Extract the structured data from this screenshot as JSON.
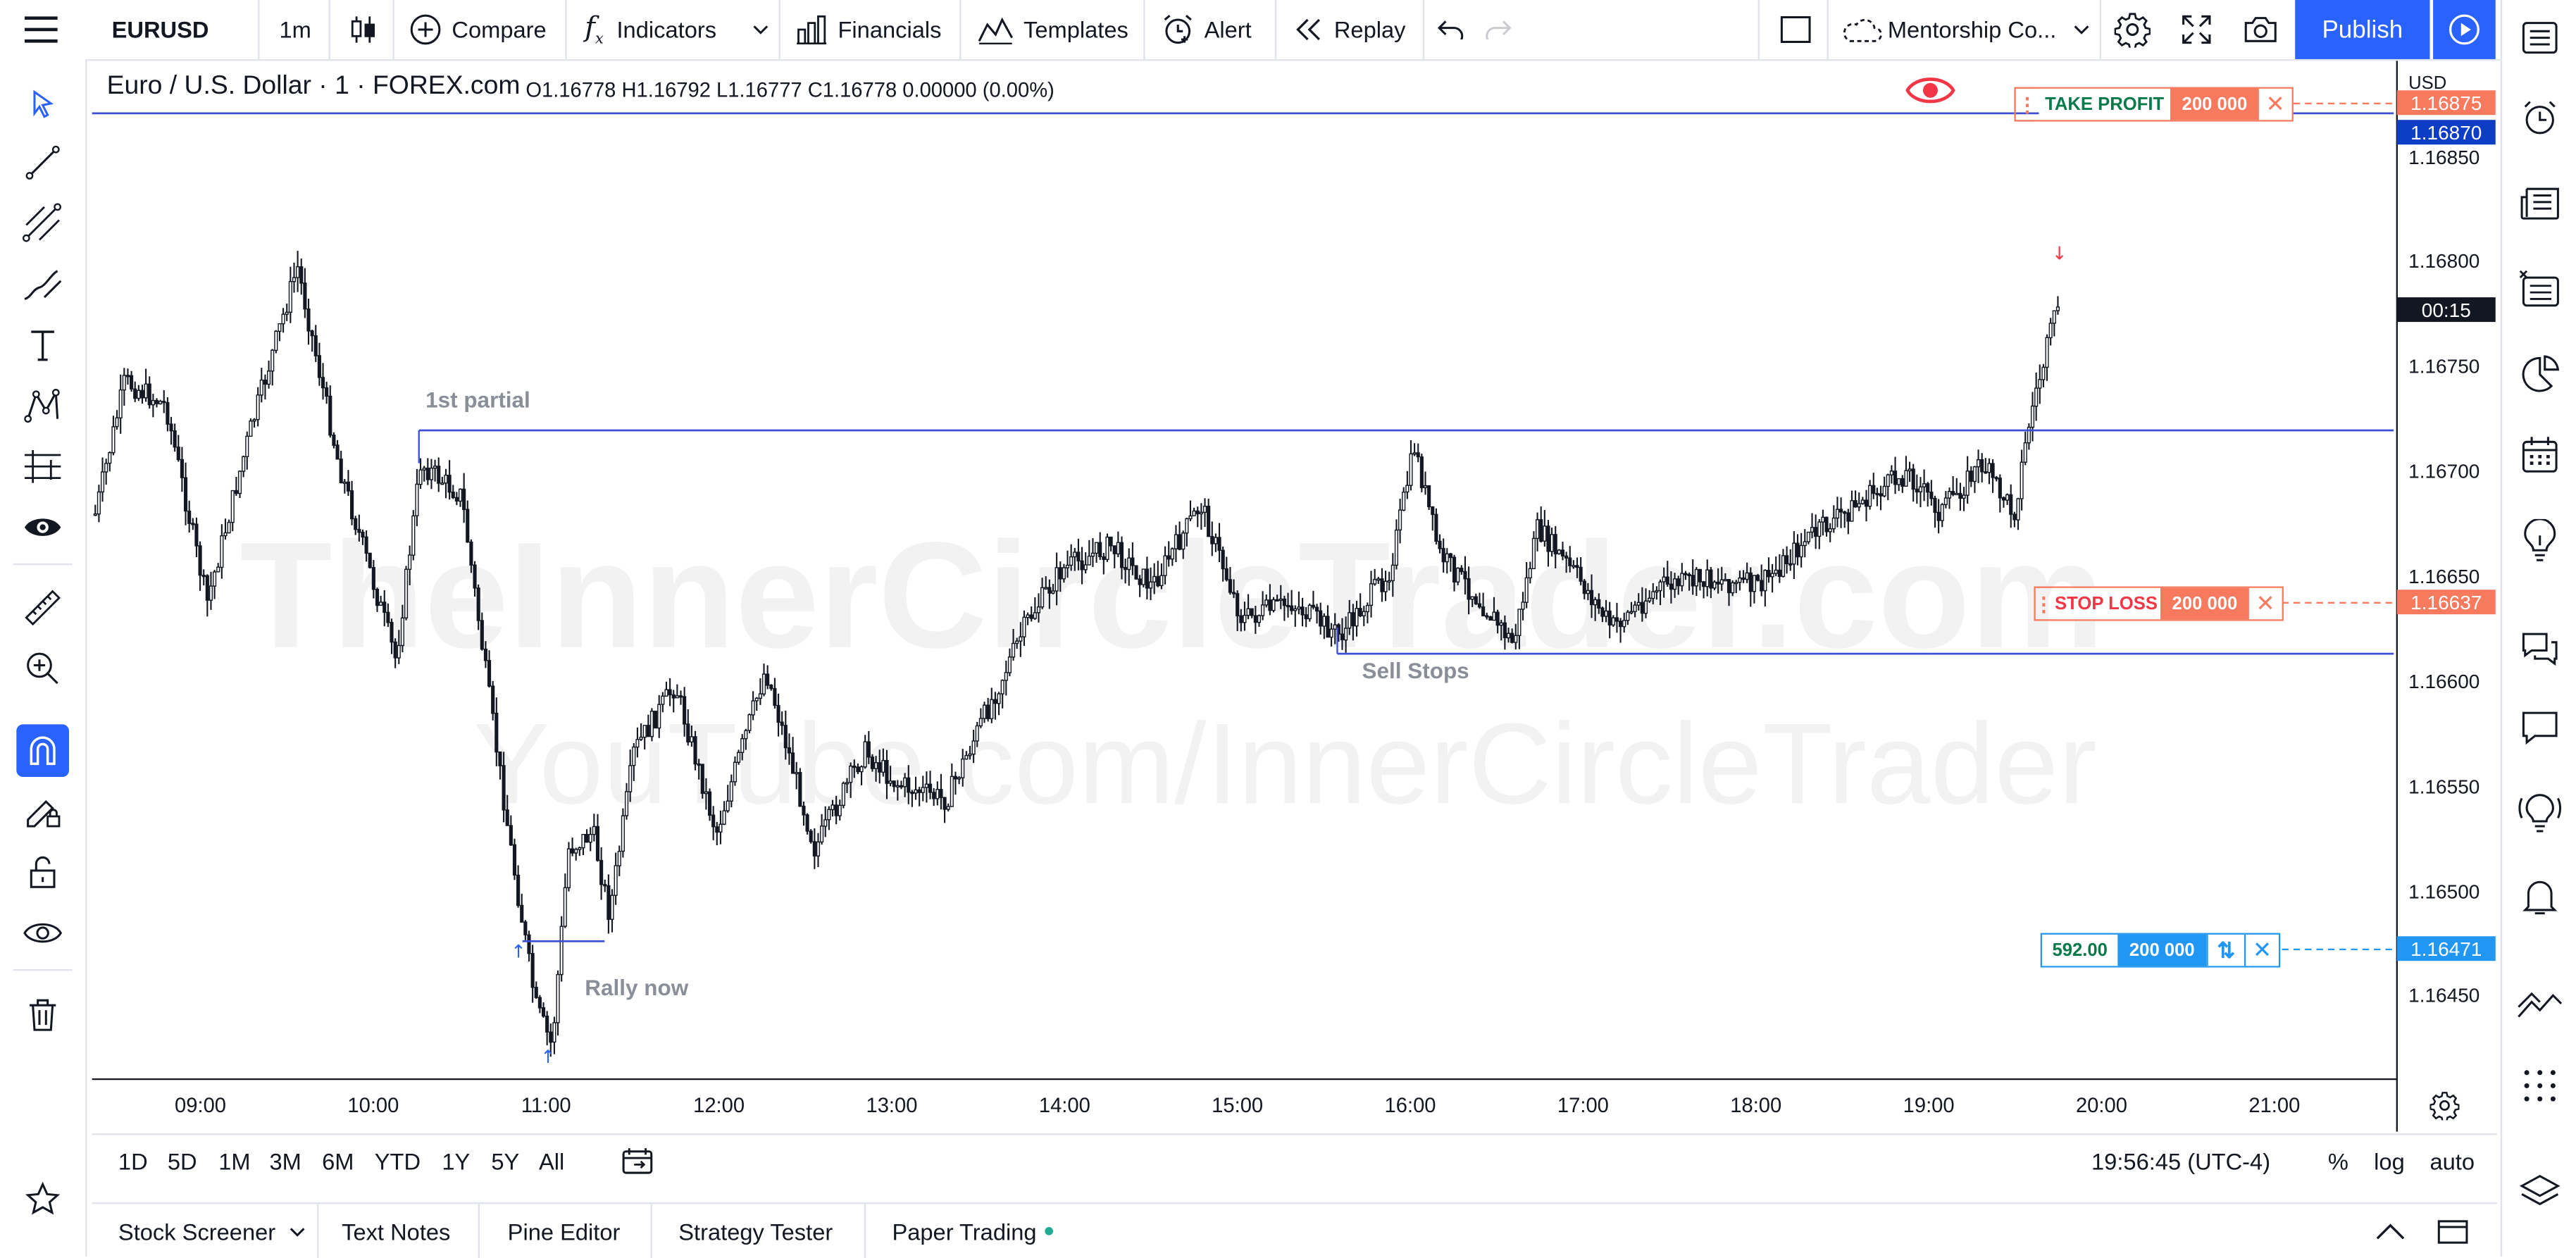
{
  "toolbar": {
    "symbol": "EURUSD",
    "interval": "1m",
    "compare": "Compare",
    "indicators": "Indicators",
    "financials": "Financials",
    "templates": "Templates",
    "alert": "Alert",
    "replay": "Replay",
    "layout_name": "Mentorship Co...",
    "publish": "Publish"
  },
  "legend": {
    "title": "Euro / U.S. Dollar · 1 · FOREX.com",
    "ohlc": "O1.16778 H1.16792 L1.16777 C1.16778 0.00000 (0.00%)"
  },
  "price_axis": {
    "currency": "USD",
    "labels": [
      "1.16850",
      "1.16800",
      "1.16750",
      "1.16700",
      "1.16650",
      "1.16600",
      "1.16550",
      "1.16500",
      "1.16450"
    ],
    "take_profit_tag": "1.16875",
    "current_level_tag": "1.16870",
    "countdown": "00:15",
    "stop_loss_tag": "1.16637",
    "entry_tag": "1.16471"
  },
  "time_axis": {
    "labels": [
      "09:00",
      "10:00",
      "11:00",
      "12:00",
      "13:00",
      "14:00",
      "15:00",
      "16:00",
      "17:00",
      "18:00",
      "19:00",
      "20:00",
      "21:00"
    ]
  },
  "annotations": {
    "first_partial": "1st partial",
    "sell_stops": "Sell Stops",
    "rally_now": "Rally now"
  },
  "watermark": {
    "line1": "TheInnerCircleTrader.com",
    "line2": "YouTube.com/InnerCircleTrader"
  },
  "orders": {
    "take_profit": {
      "label": "TAKE PROFIT",
      "qty": "200 000"
    },
    "stop_loss": {
      "label": "STOP LOSS",
      "qty": "200 000"
    },
    "position": {
      "pnl": "592.00",
      "qty": "200 000"
    }
  },
  "ranges": [
    "1D",
    "5D",
    "1M",
    "3M",
    "6M",
    "YTD",
    "1Y",
    "5Y",
    "All"
  ],
  "clock": "19:56:45 (UTC-4)",
  "scale_options": {
    "percent": "%",
    "log": "log",
    "auto": "auto"
  },
  "panels": {
    "stock_screener": "Stock Screener",
    "text_notes": "Text Notes",
    "pine_editor": "Pine Editor",
    "strategy_tester": "Strategy Tester",
    "paper_trading": "Paper Trading"
  },
  "colors": {
    "accent": "#2962ff",
    "level_line": "#3d4fd6",
    "take_profit": "#f7795e",
    "stop_loss": "#f7795e",
    "position": "#2196f3",
    "candle": "#131722"
  }
}
